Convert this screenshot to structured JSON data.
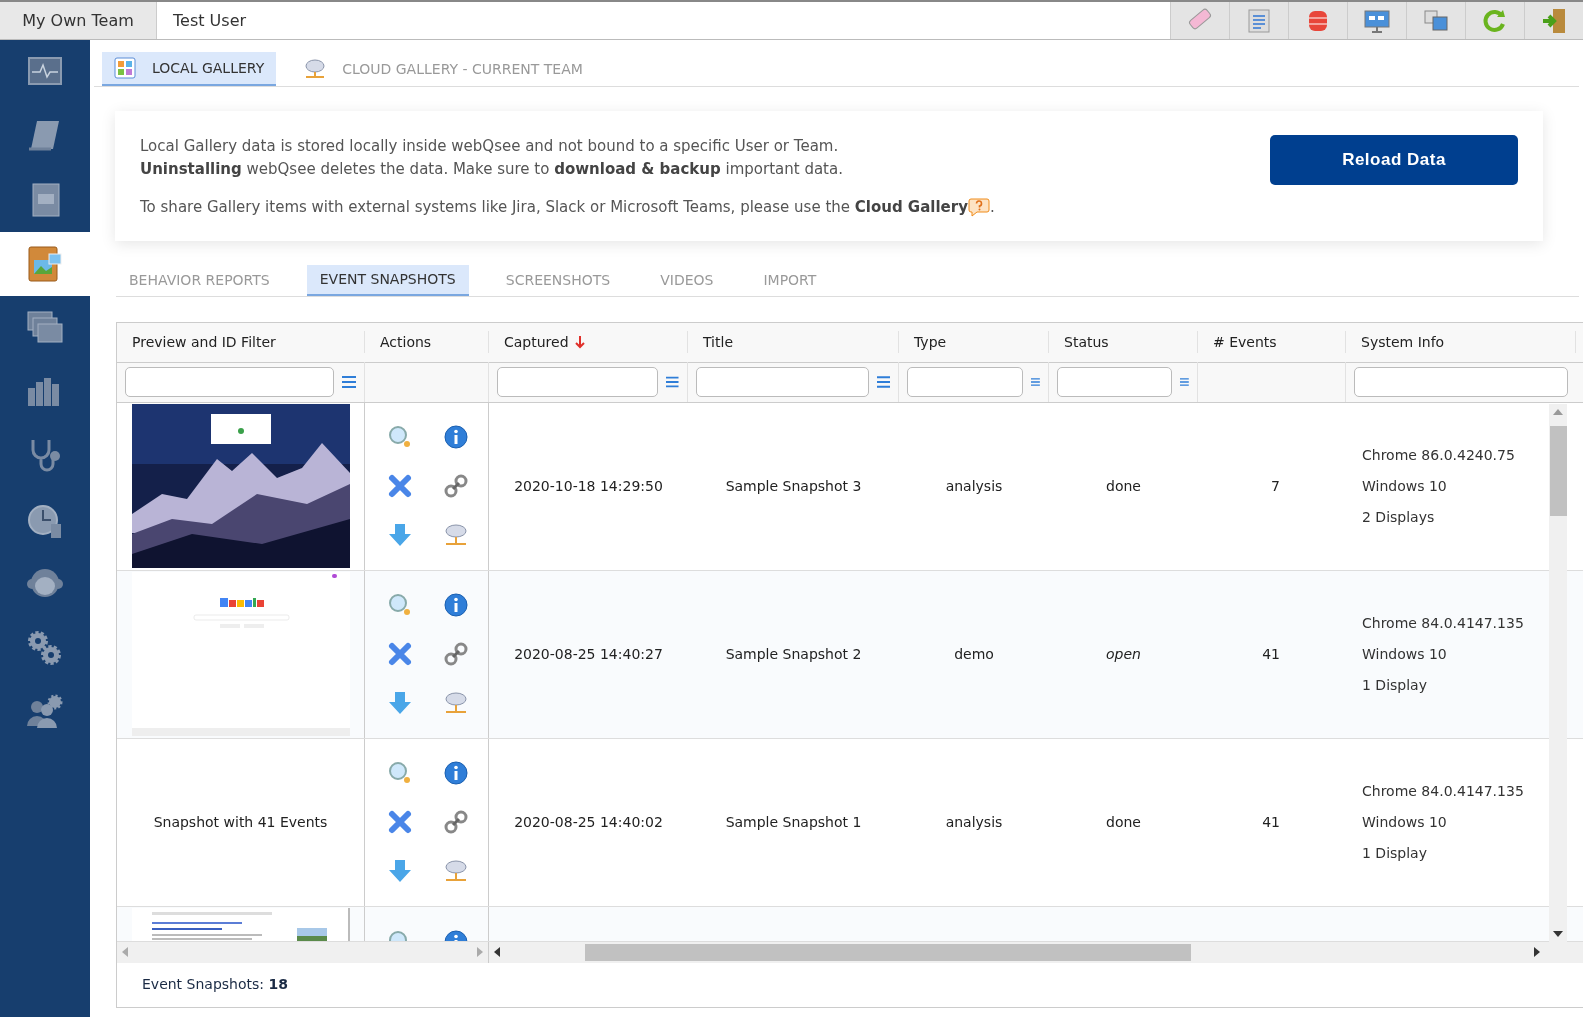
{
  "header": {
    "team": "My Own Team",
    "user": "Test User"
  },
  "sidebar": {
    "items": [
      {
        "selected": false
      },
      {
        "selected": false
      },
      {
        "selected": false
      },
      {
        "selected": true
      },
      {
        "selected": false
      },
      {
        "selected": false
      },
      {
        "selected": false
      },
      {
        "selected": false
      },
      {
        "selected": false
      },
      {
        "selected": false
      },
      {
        "selected": false
      }
    ]
  },
  "gallery_tabs": [
    {
      "label": "LOCAL GALLERY",
      "selected": true
    },
    {
      "label": "CLOUD GALLERY - CURRENT TEAM",
      "selected": false
    }
  ],
  "info": {
    "lines": [
      "Local Gallery data is stored locally inside webQsee and not bound to a specific User or Team.",
      "**Uninstalling** webQsee deletes the data. Make sure to **download & backup** important data."
    ],
    "share_note": "To share Gallery items with external systems like Jira, Slack or Microsoft Teams, please use the **Cloud Gallery**",
    "share_end": ".",
    "button": "Reload Data"
  },
  "tabs": [
    {
      "label": "BEHAVIOR REPORTS",
      "selected": false
    },
    {
      "label": "EVENT SNAPSHOTS",
      "selected": true
    },
    {
      "label": "SCREENSHOTS",
      "selected": false
    },
    {
      "label": "VIDEOS",
      "selected": false
    },
    {
      "label": "IMPORT",
      "selected": false
    }
  ],
  "table": {
    "columns": [
      {
        "label": "Preview and ID Filter",
        "filter": true,
        "filter_menu": true
      },
      {
        "label": "Actions",
        "filter": false,
        "filter_menu": false
      },
      {
        "label": "Captured",
        "filter": true,
        "filter_menu": true,
        "sorted": true
      },
      {
        "label": "Title",
        "filter": true,
        "filter_menu": true
      },
      {
        "label": "Type",
        "filter": true,
        "filter_menu": true
      },
      {
        "label": "Status",
        "filter": true,
        "filter_menu": true
      },
      {
        "label": "# Events",
        "filter": false,
        "filter_menu": false
      },
      {
        "label": "System Info",
        "filter": true,
        "filter_menu": false
      }
    ],
    "rows": [
      {
        "preview": {
          "kind": "picture"
        },
        "captured": "2020-10-18 14:29:50",
        "title": "Sample Snapshot 3",
        "type": "analysis",
        "status": "done",
        "status_italic": false,
        "events": "7",
        "system_info": [
          "Chrome 86.0.4240.75",
          "Windows 10",
          "2 Displays"
        ]
      },
      {
        "preview": {
          "kind": "picture"
        },
        "captured": "2020-08-25 14:40:27",
        "title": "Sample Snapshot 2",
        "type": "demo",
        "status": "open",
        "status_italic": true,
        "events": "41",
        "system_info": [
          "Chrome 84.0.4147.135",
          "Windows 10",
          "1 Display"
        ]
      },
      {
        "preview": {
          "kind": "text",
          "text": "Snapshot with 41 Events"
        },
        "captured": "2020-08-25 14:40:02",
        "title": "Sample Snapshot 1",
        "type": "analysis",
        "status": "done",
        "status_italic": false,
        "events": "41",
        "system_info": [
          "Chrome 84.0.4147.135",
          "Windows 10",
          "1 Display"
        ]
      },
      {
        "preview": {
          "kind": "picture"
        }
      }
    ]
  },
  "footer": "Event Snapshots: **18**"
}
